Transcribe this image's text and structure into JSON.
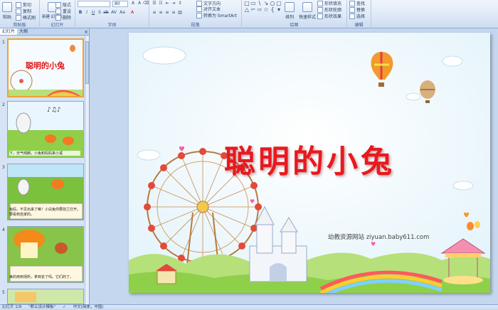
{
  "ribbon": {
    "groups": [
      {
        "label": "剪贴板"
      },
      {
        "label": "幻灯片"
      },
      {
        "label": "字体"
      },
      {
        "label": "段落"
      },
      {
        "label": "绘图"
      },
      {
        "label": "编辑"
      }
    ],
    "clipboard": {
      "paste": "粘贴",
      "cut": "剪切",
      "copy": "复制",
      "format_painter": "格式刷"
    },
    "slides": {
      "new_slide": "新建\n幻灯片",
      "layout": "版式",
      "reset": "重设",
      "delete": "删除"
    },
    "font": {
      "name": "",
      "size": "80"
    },
    "paragraph": {
      "text_direction": "文字方向",
      "align_text": "对齐文本",
      "convert_smartart": "转换为 SmartArt"
    },
    "drawing": {
      "arrange": "排列",
      "quick_styles": "快速样式",
      "shape_fill": "形状填充",
      "shape_outline": "形状轮廓",
      "shape_effects": "形状效果"
    },
    "editing": {
      "find": "查找",
      "replace": "替换",
      "select": "选择"
    }
  },
  "panel": {
    "tabs": [
      "幻灯片",
      "大纲"
    ],
    "close": "×",
    "thumbnails": [
      {
        "num": "1",
        "title": "聪明的小兔",
        "caption": ""
      },
      {
        "num": "2",
        "title": "",
        "caption": "下，天气晴朗，小兔和妈妈来小溪"
      },
      {
        "num": "3",
        "title": "",
        "caption": "兔妈，不见出来了嘛！小白兔你要找兰打开，要看到自家的。"
      },
      {
        "num": "4",
        "title": "",
        "caption": "美的用到场所，拿到去了吗。它们的了。"
      },
      {
        "num": "5",
        "title": "",
        "caption": ""
      }
    ]
  },
  "slide": {
    "title": "聪明的小兔",
    "credit": "幼教资源网站  ziyuan.baby611.com"
  },
  "statusbar": {
    "slide_count": "幻灯片 1/9",
    "theme": "\"默认设计模板\"",
    "language": "中文(简体，中国)"
  },
  "colors": {
    "title_red": "#e8191e",
    "ribbon_bg": "#dce8f7",
    "workspace_bg": "#c5d7ee",
    "selected_border": "#f0a030"
  }
}
